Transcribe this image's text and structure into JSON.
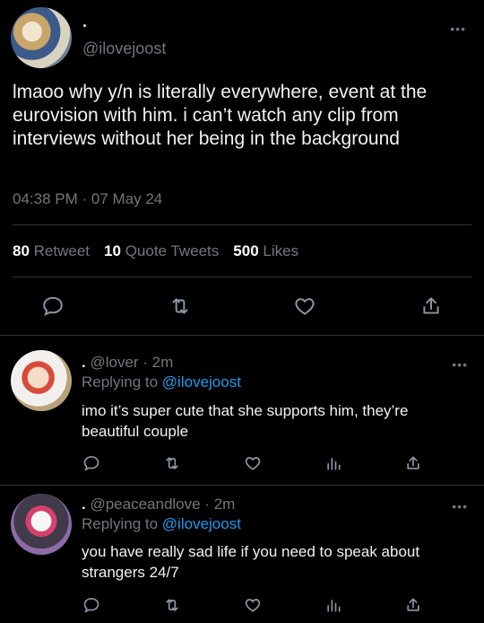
{
  "main_tweet": {
    "display_name": ".",
    "handle": "@ilovejoost",
    "text": "lmaoo why y/n is literally everywhere, event at the eurovision with him. i can’t watch any clip from interviews without her being in the background",
    "timestamp": "04:38 PM · 07 May 24",
    "retweets_count": "80",
    "retweets_label": "Retweet",
    "quotes_count": "10",
    "quotes_label": "Quote Tweets",
    "likes_count": "500",
    "likes_label": "Likes",
    "more": "•••"
  },
  "replies": [
    {
      "display_name": ".",
      "meta": "@lover · 2m",
      "replying_label": "Replying to",
      "replying_handle": "@ilovejoost",
      "text": "imo it’s super cute that she supports him, they’re beautiful couple",
      "more": "•••"
    },
    {
      "display_name": ".",
      "meta": "@peaceandlove · 2m",
      "replying_label": "Replying to",
      "replying_handle": "@ilovejoost",
      "text": "you have really sad life if you need to speak about strangers 24/7",
      "more": "•••"
    }
  ],
  "colors": {
    "background": "#000000",
    "text": "#e7e9ea",
    "muted": "#71767b",
    "accent": "#1d9bf0",
    "divider": "#2f3336"
  },
  "icons": [
    "reply-icon",
    "retweet-icon",
    "like-icon",
    "share-icon",
    "analytics-icon"
  ]
}
